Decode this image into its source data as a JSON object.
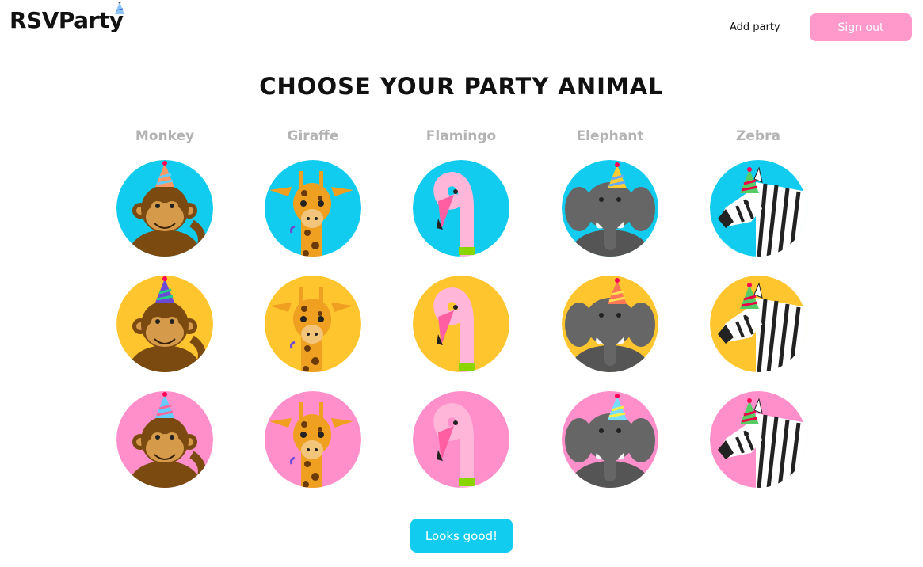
{
  "header": {
    "logo_text": "RSVParty",
    "add_party_label": "Add party",
    "sign_out_label": "Sign out"
  },
  "page_title": "CHOOSE YOUR PARTY ANIMAL",
  "animals": [
    {
      "name": "Monkey",
      "icon": "monkey-icon"
    },
    {
      "name": "Giraffe",
      "icon": "giraffe-icon"
    },
    {
      "name": "Flamingo",
      "icon": "flamingo-icon"
    },
    {
      "name": "Elephant",
      "icon": "elephant-icon"
    },
    {
      "name": "Zebra",
      "icon": "zebra-icon"
    }
  ],
  "background_colors": [
    "#11ccee",
    "#ffc52e",
    "#ff8fcb"
  ],
  "confirm_label": "Looks good!",
  "colors": {
    "accent_blue": "#11ccee",
    "accent_pink": "#ff99cc",
    "accent_yellow": "#ffc52e"
  }
}
